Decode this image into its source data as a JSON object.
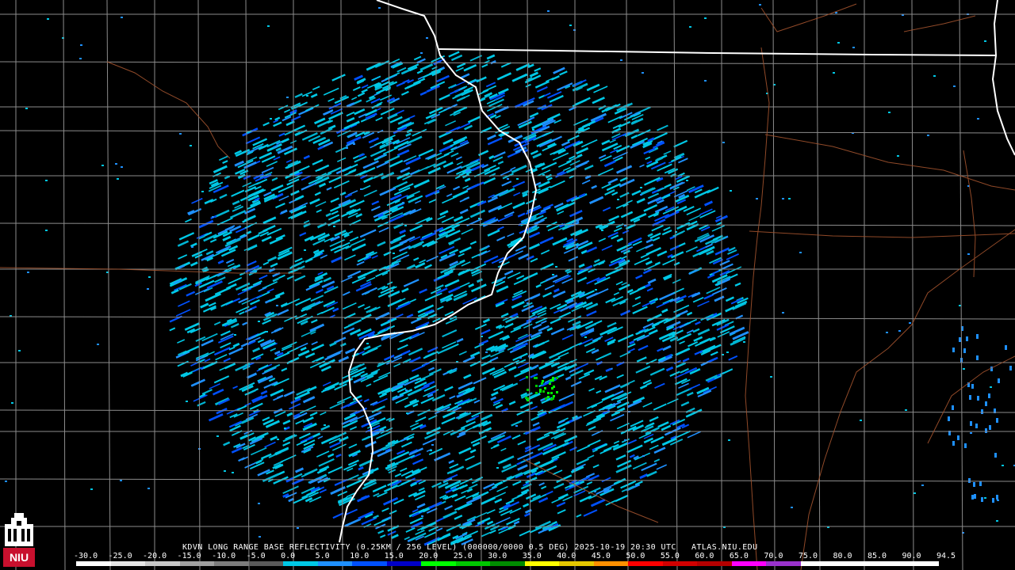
{
  "product_title": "KDVN LONG RANGE BASE REFLECTIVITY (0.25KM / 256 LEVEL) (000000/0000 0.5 DEG) 2025-10-19 20:30 UTC   ATLAS.NIU.EDU",
  "logo": {
    "text": "NIU"
  },
  "legend": {
    "ticks": [
      "-30.0",
      "-25.0",
      "-20.0",
      "-15.0",
      "-10.0",
      "-5.0",
      "0.0",
      "5.0",
      "10.0",
      "15.0",
      "20.0",
      "25.0",
      "30.0",
      "35.0",
      "40.0",
      "45.0",
      "50.0",
      "55.0",
      "60.0",
      "65.0",
      "70.0",
      "75.0",
      "80.0",
      "85.0",
      "90.0",
      "94.5"
    ],
    "colors": [
      "#ffffff",
      "#e6e6e6",
      "#c8c8c8",
      "#a0a0a0",
      "#7d7d7d",
      "#5a5a5a",
      "#00c8e6",
      "#1e90ff",
      "#0050ff",
      "#0000c8",
      "#00ff00",
      "#00c800",
      "#008c00",
      "#ffff00",
      "#e6c800",
      "#ff9000",
      "#ff0000",
      "#d20000",
      "#b40000",
      "#ff00ff",
      "#9932cc",
      "#ffffff",
      "#ffffff",
      "#ffffff",
      "#ffffff"
    ]
  },
  "map_colors": {
    "state_border": "#ffffff",
    "county_border": "#8c8c8c",
    "highway": "#a0522d",
    "background": "#000000"
  }
}
